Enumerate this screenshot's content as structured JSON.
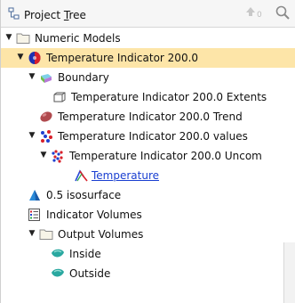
{
  "panel": {
    "title_prefix": "Project ",
    "title_accel": "T",
    "title_suffix": "ree",
    "up_count": "0"
  },
  "tree": [
    {
      "label": "Numeric Models",
      "icon": "folder-icon",
      "expanded": true
    },
    {
      "label": "Temperature Indicator 200.0",
      "icon": "indicator-model-icon",
      "expanded": true,
      "selected": true
    },
    {
      "label": "Boundary",
      "icon": "boundary-icon",
      "expanded": true
    },
    {
      "label": "Temperature Indicator 200.0 Extents",
      "icon": "extents-icon"
    },
    {
      "label": "Temperature Indicator 200.0 Trend",
      "icon": "trend-ellipsoid-icon"
    },
    {
      "label": "Temperature Indicator 200.0 values",
      "icon": "values-points-icon",
      "expanded": true
    },
    {
      "label": "Temperature Indicator 200.0 Uncom",
      "icon": "uncomposited-points-icon",
      "expanded": true
    },
    {
      "label": "Temperature",
      "icon": "temperature-line-icon",
      "link": true
    },
    {
      "label": "0.5 isosurface",
      "icon": "isosurface-icon"
    },
    {
      "label": "Indicator Volumes",
      "icon": "volumes-list-icon"
    },
    {
      "label": "Output Volumes",
      "icon": "folder-icon",
      "expanded": true
    },
    {
      "label": "Inside",
      "icon": "inside-volume-icon"
    },
    {
      "label": "Outside",
      "icon": "outside-volume-icon"
    }
  ]
}
